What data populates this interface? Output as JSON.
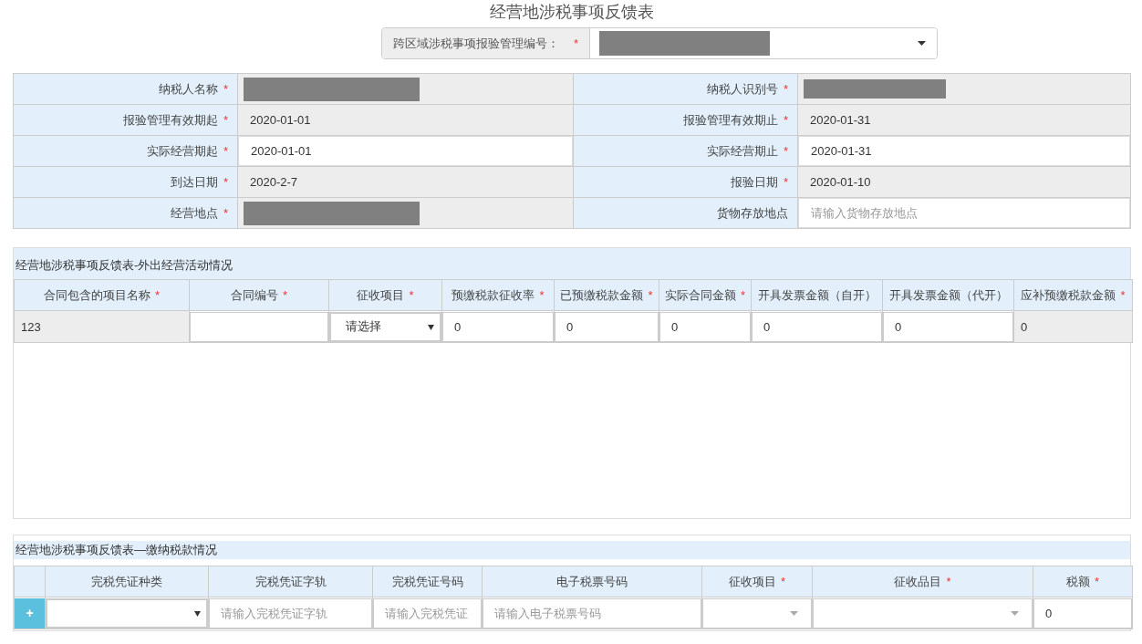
{
  "title": "经营地涉税事项反馈表",
  "required_mark": "*",
  "header_field": {
    "label": "跨区域涉税事项报验管理编号：",
    "required": true,
    "kind": "redacted"
  },
  "form": {
    "rows": [
      [
        {
          "label": "纳税人名称",
          "required": true,
          "kind": "redacted"
        },
        {
          "label": "纳税人识别号",
          "required": true,
          "kind": "redacted"
        }
      ],
      [
        {
          "label": "报验管理有效期起",
          "required": true,
          "kind": "readonly",
          "value": "2020-01-01"
        },
        {
          "label": "报验管理有效期止",
          "required": true,
          "kind": "readonly",
          "value": "2020-01-31"
        }
      ],
      [
        {
          "label": "实际经营期起",
          "required": true,
          "kind": "input",
          "value": "2020-01-01"
        },
        {
          "label": "实际经营期止",
          "required": true,
          "kind": "input",
          "value": "2020-01-31"
        }
      ],
      [
        {
          "label": "到达日期",
          "required": true,
          "kind": "readonly",
          "value": "2020-2-7"
        },
        {
          "label": "报验日期",
          "required": true,
          "kind": "readonly",
          "value": "2020-01-10"
        }
      ],
      [
        {
          "label": "经营地点",
          "required": true,
          "kind": "redacted"
        },
        {
          "label": "货物存放地点",
          "required": false,
          "kind": "input",
          "placeholder": "请输入货物存放地点"
        }
      ]
    ]
  },
  "activity_table": {
    "title": "经营地涉税事项反馈表-外出经营活动情况",
    "columns": [
      {
        "label": "合同包含的项目名称",
        "required": true
      },
      {
        "label": "合同编号",
        "required": true
      },
      {
        "label": "征收项目",
        "required": true
      },
      {
        "label": "预缴税款征收率",
        "required": true
      },
      {
        "label": "已预缴税款金额",
        "required": true
      },
      {
        "label": "实际合同金额",
        "required": true
      },
      {
        "label": "开具发票金额（自开）",
        "required": false
      },
      {
        "label": "开具发票金额（代开）",
        "required": false
      },
      {
        "label": "应补预缴税款金额",
        "required": true
      }
    ],
    "row": [
      {
        "kind": "readonly",
        "value": "123"
      },
      {
        "kind": "input"
      },
      {
        "kind": "select",
        "value": "请选择"
      },
      {
        "kind": "input",
        "value": "0"
      },
      {
        "kind": "input",
        "value": "0"
      },
      {
        "kind": "input",
        "value": "0"
      },
      {
        "kind": "input",
        "value": "0"
      },
      {
        "kind": "input",
        "value": "0"
      },
      {
        "kind": "readonly",
        "value": "0"
      }
    ]
  },
  "payment_table": {
    "title": "经营地涉税事项反馈表—缴纳税款情况",
    "columns": [
      {
        "label": "完税凭证种类",
        "required": false
      },
      {
        "label": "完税凭证字轨",
        "required": false
      },
      {
        "label": "完税凭证号码",
        "required": false
      },
      {
        "label": "电子税票号码",
        "required": false
      },
      {
        "label": "征收项目",
        "required": true
      },
      {
        "label": "征收品目",
        "required": true
      },
      {
        "label": "税额",
        "required": true
      }
    ],
    "add_button": "+",
    "row": [
      {
        "kind": "select"
      },
      {
        "kind": "input",
        "placeholder": "请输入完税凭证字轨"
      },
      {
        "kind": "input",
        "placeholder": "请输入完税凭证"
      },
      {
        "kind": "input",
        "placeholder": "请输入电子税票号码"
      },
      {
        "kind": "combo"
      },
      {
        "kind": "combo"
      },
      {
        "kind": "input",
        "value": "0"
      }
    ]
  }
}
